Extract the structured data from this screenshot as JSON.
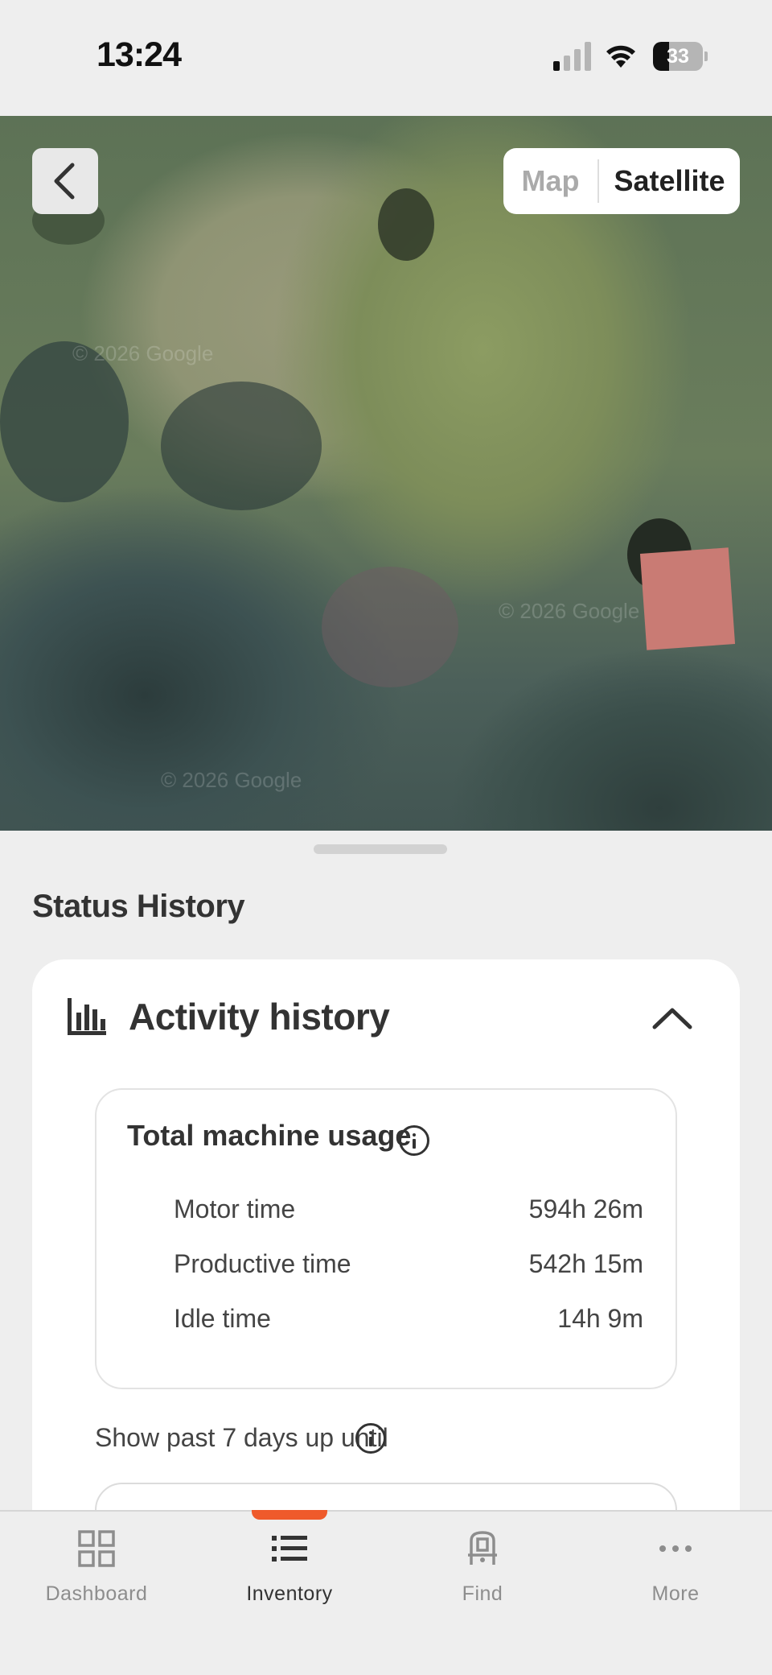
{
  "status_bar": {
    "time": "13:24",
    "battery": "33",
    "battery_level": 0.33
  },
  "map": {
    "type_toggle": {
      "map_label": "Map",
      "satellite_label": "Satellite",
      "selected": "Satellite"
    },
    "watermark": "© 2026 Google"
  },
  "sheet": {
    "title": "Status History",
    "activity": {
      "title": "Activity history",
      "expanded": true,
      "usage": {
        "title": "Total machine usage",
        "rows": [
          {
            "label": "Motor time",
            "value": "594h 26m"
          },
          {
            "label": "Productive time",
            "value": "542h 15m"
          },
          {
            "label": "Idle time",
            "value": "14h 9m"
          }
        ]
      },
      "show_past_label": "Show past 7 days up until"
    }
  },
  "bottom_nav": {
    "active": "Inventory",
    "accent_color": "#ef5a2b",
    "items": [
      {
        "label": "Dashboard",
        "icon": "grid-icon"
      },
      {
        "label": "Inventory",
        "icon": "list-icon"
      },
      {
        "label": "Find",
        "icon": "machine-icon"
      },
      {
        "label": "More",
        "icon": "more-dots-icon"
      }
    ]
  }
}
